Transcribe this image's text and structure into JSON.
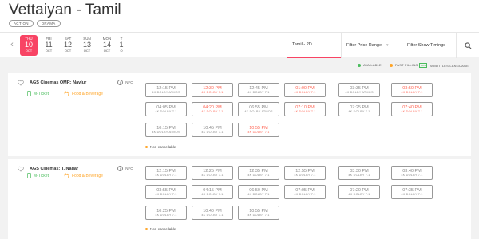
{
  "movie": {
    "title": "Vettaiyan - Tamil",
    "genres": [
      "ACTION",
      "DRAMA"
    ]
  },
  "dates": [
    {
      "dow": "THU",
      "day": "10",
      "mon": "OCT",
      "active": true
    },
    {
      "dow": "FRI",
      "day": "11",
      "mon": "OCT",
      "active": false
    },
    {
      "dow": "SAT",
      "day": "12",
      "mon": "OCT",
      "active": false
    },
    {
      "dow": "SUN",
      "day": "13",
      "mon": "OCT",
      "active": false
    },
    {
      "dow": "MON",
      "day": "14",
      "mon": "OCT",
      "active": false
    },
    {
      "dow": "T",
      "day": "1",
      "mon": "O",
      "active": false
    }
  ],
  "filters": {
    "language": "Tamil - 2D",
    "price": "Filter Price Range",
    "timings": "Filter Show Timings"
  },
  "legend": {
    "available": "AVAILABLE",
    "fast": "FAST FILLING",
    "subtitles_tag": "LAN",
    "subtitles": "SUBTITLES LANGUAGE"
  },
  "colors": {
    "accent": "#f84464",
    "available": "#4abd5d",
    "fast": "#ffa426"
  },
  "cinemas": [
    {
      "name": "AGS Cinemas OMR: Navlur",
      "info": "INFO",
      "mticket": "M-Ticket",
      "food": "Food & Beverage",
      "shows": [
        {
          "time": "12:15 PM",
          "format": "4K DOLBY ATMOS",
          "status": "available"
        },
        {
          "time": "12:30 PM",
          "format": "4K DOLBY 7.1",
          "status": "red"
        },
        {
          "time": "12:45 PM",
          "format": "4K DOLBY 7.1",
          "status": "available"
        },
        {
          "time": "01:00 PM",
          "format": "4K DOLBY 7.1",
          "status": "red"
        },
        {
          "time": "03:35 PM",
          "format": "4K DOLBY ATMOS",
          "status": "available"
        },
        {
          "time": "03:50 PM",
          "format": "4K DOLBY 7.1",
          "status": "red"
        },
        {
          "time": "04:05 PM",
          "format": "4K DOLBY 7.1",
          "status": "available"
        },
        {
          "time": "04:20 PM",
          "format": "4K DOLBY 7.1",
          "status": "red"
        },
        {
          "time": "06:55 PM",
          "format": "4K DOLBY ATMOS",
          "status": "available"
        },
        {
          "time": "07:10 PM",
          "format": "4K DOLBY 7.1",
          "status": "red"
        },
        {
          "time": "07:25 PM",
          "format": "4K DOLBY 7.1",
          "status": "available"
        },
        {
          "time": "07:40 PM",
          "format": "4K DOLBY 7.1",
          "status": "red"
        },
        {
          "time": "10:15 PM",
          "format": "4K DOLBY ATMOS",
          "status": "available"
        },
        {
          "time": "10:45 PM",
          "format": "4K DOLBY 7.1",
          "status": "available"
        },
        {
          "time": "10:55 PM",
          "format": "4K DOLBY 7.1",
          "status": "red"
        }
      ],
      "note": "Non-cancellable"
    },
    {
      "name": "AGS Cinemas: T. Nagar",
      "info": "INFO",
      "mticket": "M-Ticket",
      "food": "Food & Beverage",
      "shows": [
        {
          "time": "12:15 PM",
          "format": "4K DOLBY 7.1",
          "status": "available"
        },
        {
          "time": "12:25 PM",
          "format": "4K DOLBY 7.1",
          "status": "available"
        },
        {
          "time": "12:35 PM",
          "format": "4K DOLBY 7.1",
          "status": "available"
        },
        {
          "time": "12:55 PM",
          "format": "4K DOLBY 7.1",
          "status": "available"
        },
        {
          "time": "03:30 PM",
          "format": "4K DOLBY 7.1",
          "status": "available"
        },
        {
          "time": "03:40 PM",
          "format": "4K DOLBY 7.1",
          "status": "available"
        },
        {
          "time": "03:55 PM",
          "format": "4K DOLBY 7.1",
          "status": "available"
        },
        {
          "time": "04:15 PM",
          "format": "4K DOLBY 7.1",
          "status": "available"
        },
        {
          "time": "06:50 PM",
          "format": "4K DOLBY 7.1",
          "status": "available"
        },
        {
          "time": "07:05 PM",
          "format": "4K DOLBY 7.1",
          "status": "available"
        },
        {
          "time": "07:20 PM",
          "format": "4K DOLBY 7.1",
          "status": "available"
        },
        {
          "time": "07:35 PM",
          "format": "4K DOLBY 7.1",
          "status": "available"
        },
        {
          "time": "10:25 PM",
          "format": "4K DOLBY 7.1",
          "status": "available"
        },
        {
          "time": "10:40 PM",
          "format": "4K DOLBY 7.1",
          "status": "available"
        },
        {
          "time": "10:55 PM",
          "format": "4K DOLBY 7.1",
          "status": "available"
        }
      ],
      "note": "Non-cancellable"
    }
  ]
}
